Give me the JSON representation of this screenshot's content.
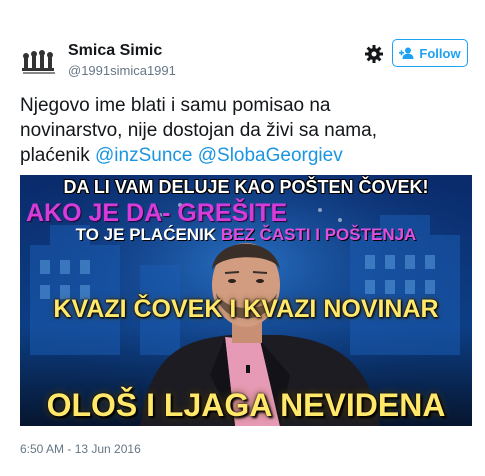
{
  "user": {
    "display_name": "Smica Simic",
    "handle": "@1991simica1991",
    "avatar_icon": "chess-pieces-avatar"
  },
  "actions": {
    "settings_icon": "gear-icon",
    "follow_label": "Follow",
    "follow_icon": "add-user-icon",
    "accent_color": "#1da1f2"
  },
  "tweet": {
    "text_line1": "Njegovo ime blati i samu pomisao na",
    "text_line2": "novinarstvo, nije dostojan da živi sa nama,",
    "text_prefix": "plaćenik",
    "mention_1": "@inzSunce",
    "mention_2": "@SlobaGeorgiev",
    "mention_color": "#1b95e0"
  },
  "media": {
    "caption_1": "DA LI VAM DELUJE KAO POŠTEN ČOVEK!",
    "caption_2": "AKO JE DA- GREŠITE",
    "caption_3a": "TO JE PLAĆENIK ",
    "caption_3b": "BEZ ČASTI I POŠTENJA",
    "caption_4": "KVAZI ČOVEK I KVAZI NOVINAR",
    "caption_5": "OLOŠ I LJAGA NEVIDENA"
  },
  "timestamp": "6:50 AM - 13 Jun 2016"
}
